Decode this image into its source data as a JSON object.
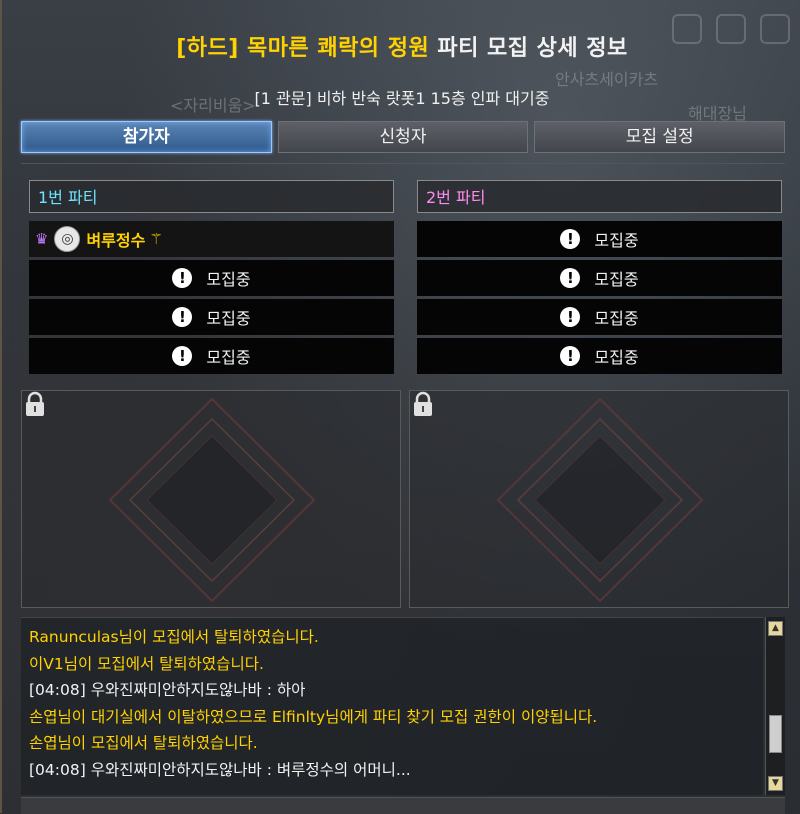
{
  "title": {
    "highlight": "[하드] 목마른 쾌락의 정원",
    "rest": "파티 모집 상세 정보"
  },
  "subtitle": "[1 관문] 비하 반숙 랏폿1 15층 인파 대기중",
  "background_ghost": [
    "<자리비움>",
    "안사츠세이카츠",
    "해대장님"
  ],
  "tabs": [
    {
      "label": "참가자",
      "active": true
    },
    {
      "label": "신청자",
      "active": false
    },
    {
      "label": "모집 설정",
      "active": false
    }
  ],
  "parties": [
    {
      "header": "1번 파티",
      "member": {
        "name": "벼루정수"
      },
      "slots": [
        "모집중",
        "모집중",
        "모집중"
      ]
    },
    {
      "header": "2번 파티",
      "slots": [
        "모집중",
        "모집중",
        "모집중",
        "모집중"
      ]
    }
  ],
  "chat": [
    {
      "type": "sys",
      "text": "Ranunculas님이 모집에서 탈퇴하였습니다."
    },
    {
      "type": "sys",
      "text": "이V1님이 모집에서 탈퇴하였습니다."
    },
    {
      "type": "user",
      "text": "[04:08] 우와진짜미안하지도않나바 : 하아"
    },
    {
      "type": "sys",
      "text": "손엽님이 대기실에서 이탈하였으므로 Elfinlty님에게 파티 찾기 모집 권한이 이양됩니다."
    },
    {
      "type": "sys",
      "text": "손엽님이 모집에서 탈퇴하였습니다."
    },
    {
      "type": "user",
      "text": "[04:08] 우와진짜미안하지도않나바 : 벼루정수의 어머니..."
    }
  ],
  "colors": {
    "accent_gold": "#ffd200",
    "party1": "#6fe3ff",
    "party2": "#ff8cf0",
    "tab_active": "#2f5a8c"
  }
}
